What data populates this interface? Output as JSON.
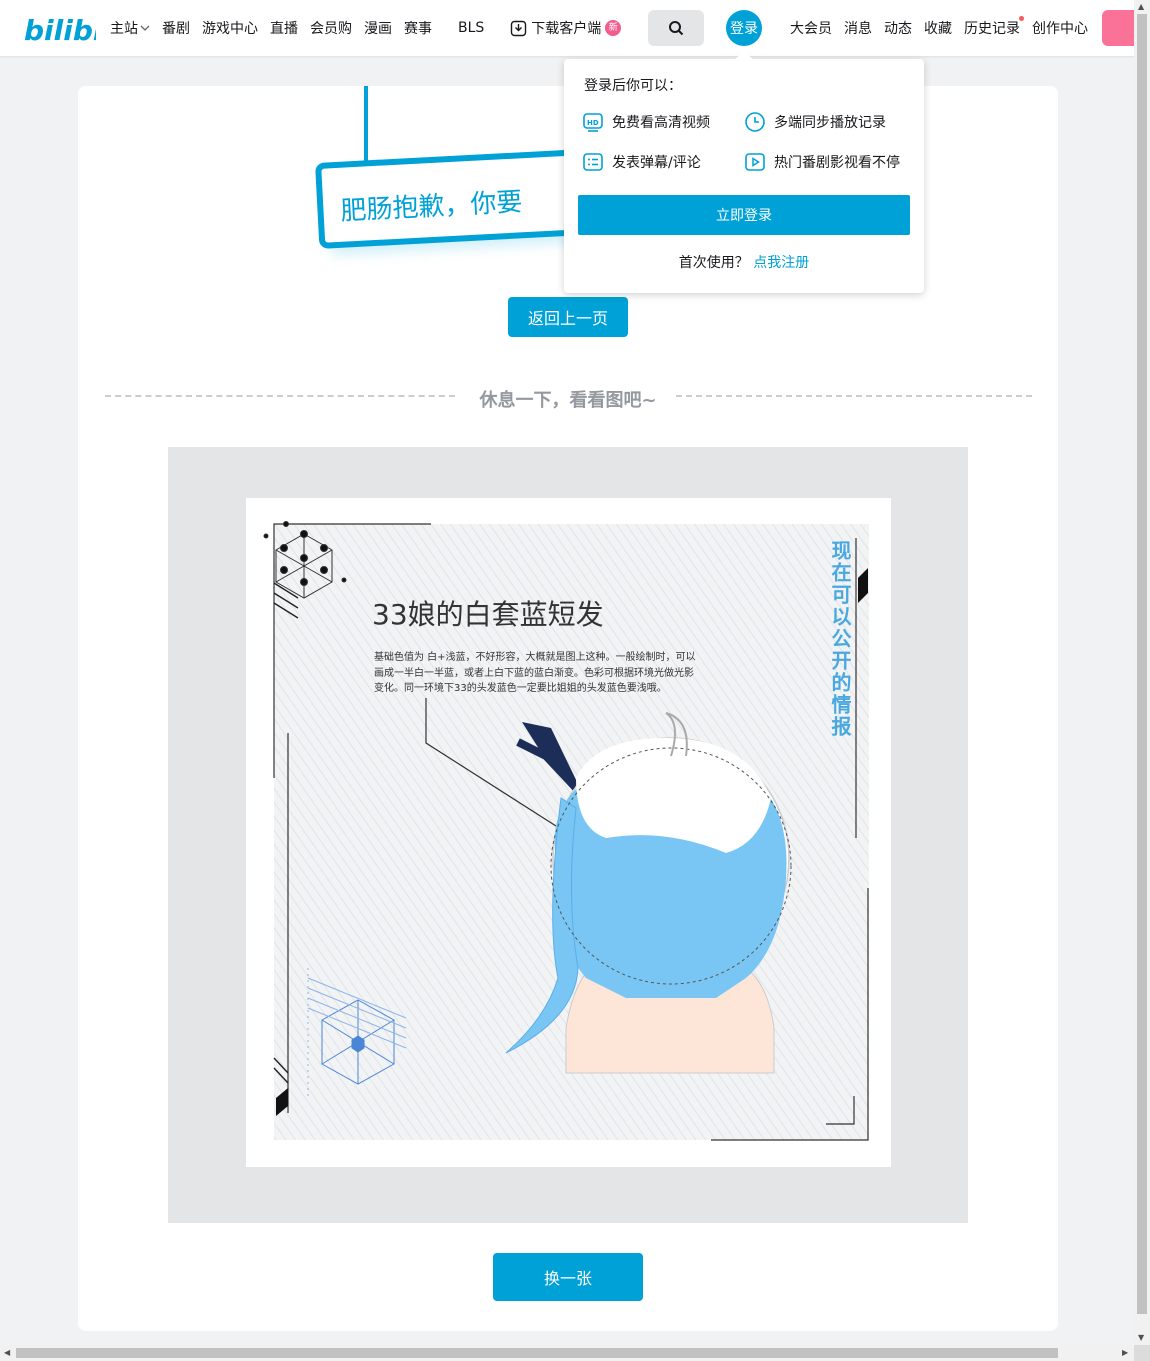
{
  "header": {
    "logo_text": "bilibili",
    "nav_left": [
      "主站",
      "番剧",
      "游戏中心",
      "直播",
      "会员购",
      "漫画",
      "赛事",
      "BLS"
    ],
    "download": {
      "label": "下载客户端",
      "badge": "新"
    },
    "login_avatar": "登录",
    "nav_right": [
      "大会员",
      "消息",
      "动态",
      "收藏",
      "历史记录",
      "创作中心"
    ]
  },
  "sign": {
    "text": "肥肠抱歉，你要"
  },
  "main": {
    "back_button": "返回上一页",
    "divider_text": "休息一下，看看图吧~",
    "swap_button": "换一张"
  },
  "picture": {
    "title": "33娘的白套蓝短发",
    "body_lines": [
      "基础色值为 白+浅蓝，不好形容，大概就是图上这种。一般绘制时，可以",
      "画成一半白一半蓝，或者上白下蓝的蓝白渐变。色彩可根据环境光做光影",
      "变化。同一环境下33的头发蓝色一定要比姐姐的头发蓝色要浅哦。"
    ],
    "vertical_caption": "现在可以公开的情报"
  },
  "popover": {
    "title": "登录后你可以：",
    "features": [
      {
        "label": "免费看高清视频",
        "icon": "hd-icon"
      },
      {
        "label": "多端同步播放记录",
        "icon": "clock-icon"
      },
      {
        "label": "发表弹幕/评论",
        "icon": "list-icon"
      },
      {
        "label": "热门番剧影视看不停",
        "icon": "play-icon"
      }
    ],
    "login_button": "立即登录",
    "register_prompt": "首次使用？",
    "register_link": "点我注册"
  },
  "colors": {
    "brand": "#00a1d6",
    "pink": "#fb7299"
  }
}
